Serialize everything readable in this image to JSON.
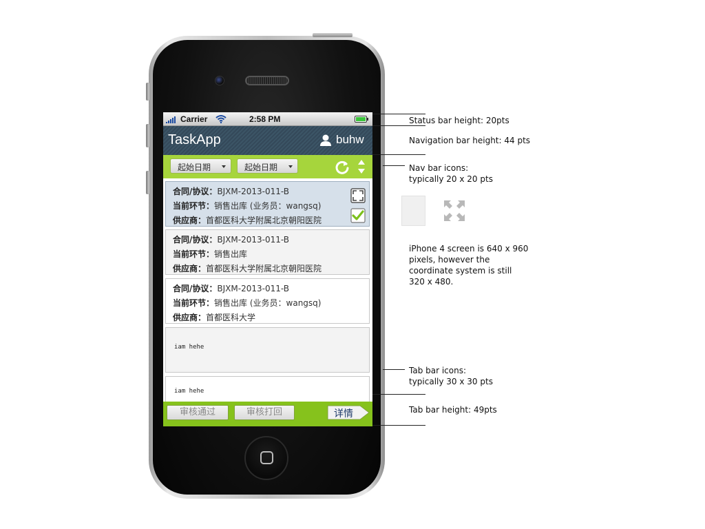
{
  "status_bar": {
    "carrier": "Carrier",
    "time": "2:58 PM",
    "battery": "battery-full-icon"
  },
  "nav_bar": {
    "title": "TaskApp",
    "user_icon": "user-icon",
    "user_name": "buhw"
  },
  "filter_bar": {
    "start_date_1": "起始日期",
    "start_date_2": "起始日期",
    "refresh_icon": "refresh-icon",
    "sort_icon": "sort-icon"
  },
  "list": {
    "items": [
      {
        "contract_label": "合同/协议",
        "contract_value": "BJXM-2013-011-B",
        "stage_label": "当前环节",
        "stage_value": "销售出库 (业务员：wangsq)",
        "supplier_label": "供应商",
        "supplier_value": "首都医科大学附属北京朝阳医院",
        "selected": true,
        "checked": true
      },
      {
        "contract_label": "合同/协议",
        "contract_value": "BJXM-2013-011-B",
        "stage_label": "当前环节",
        "stage_value": "销售出库",
        "supplier_label": "供应商",
        "supplier_value": "首都医科大学附属北京朝阳医院"
      },
      {
        "contract_label": "合同/协议",
        "contract_value": "BJXM-2013-011-B",
        "stage_label": "当前环节",
        "stage_value": "销售出库 (业务员：wangsq)",
        "supplier_label": "供应商",
        "supplier_value": "首都医科大学"
      },
      {
        "text": "iam hehe"
      },
      {
        "text": "iam hehe"
      }
    ]
  },
  "tab_bar": {
    "approve": "审核通过",
    "reject": "审核打回",
    "detail": "详情"
  },
  "annotations": {
    "status_bar": "Status bar height: 20pts",
    "nav_bar": "Navigation bar height: 44 pts",
    "nav_icons": "Nav bar icons:\ntypically 20 x 20 pts",
    "screen": "iPhone 4 screen is 640 x 960\npixels, however the\ncoordinate system is still\n320 x 480.",
    "tab_icons": "Tab bar icons:\ntypically 30 x 30 pts",
    "tab_bar": "Tab bar height: 49pts"
  },
  "colors": {
    "nav_bar": "#3c5566",
    "filter_bar": "#a6d53c",
    "tab_bar": "#86c21c",
    "selected_card": "#d6e0ea",
    "check": "#7cc01c"
  }
}
